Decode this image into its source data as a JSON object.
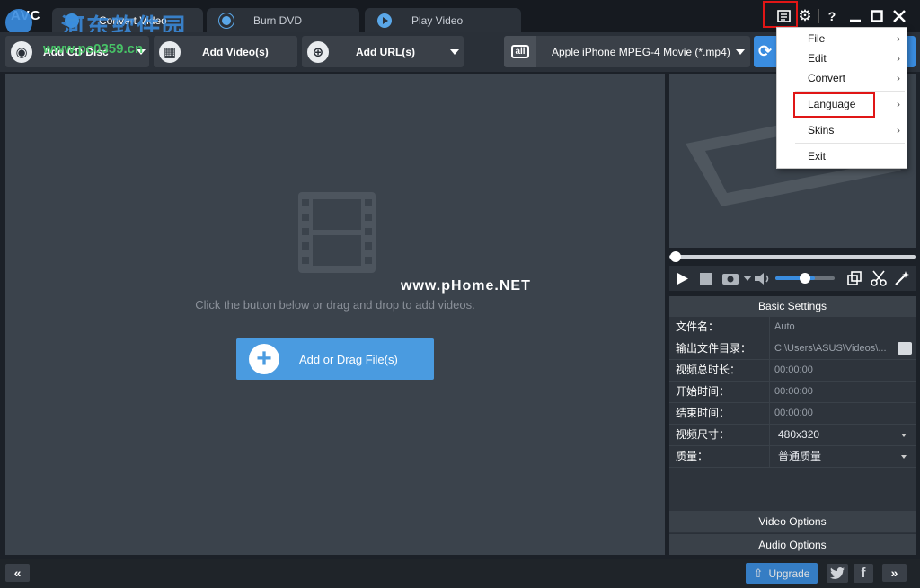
{
  "app": {
    "logo": "AVC"
  },
  "watermark": {
    "line1": "河东软件园",
    "line2": "www.pc0359.cn",
    "center": "www.pHome.NET"
  },
  "tabs": [
    {
      "label": "Convert Video"
    },
    {
      "label": "Burn DVD"
    },
    {
      "label": "Play Video"
    }
  ],
  "window_controls": {
    "help": "?"
  },
  "toolbar": {
    "add_cd": "Add CD Disc",
    "add_video": "Add Video(s)",
    "add_url": "Add URL(s)",
    "format_icon_label": "all",
    "format_value": "Apple iPhone MPEG-4 Movie (*.mp4)"
  },
  "main": {
    "hint": "Click the button below or drag and drop to add videos.",
    "add_button": "Add or Drag File(s)"
  },
  "settings": {
    "title": "Basic Settings",
    "rows": [
      {
        "k": "文件名：",
        "v": "Auto"
      },
      {
        "k": "输出文件目录：",
        "v": "C:\\Users\\ASUS\\Videos\\..."
      },
      {
        "k": "视频总时长：",
        "v": "00:00:00"
      },
      {
        "k": "开始时间：",
        "v": "00:00:00"
      },
      {
        "k": "结束时间：",
        "v": "00:00:00"
      },
      {
        "k": "视频尺寸：",
        "v": "480x320"
      },
      {
        "k": "质量：",
        "v": "普通质量"
      }
    ],
    "video_options": "Video Options",
    "audio_options": "Audio Options"
  },
  "menu": {
    "items": [
      {
        "label": "File"
      },
      {
        "label": "Edit"
      },
      {
        "label": "Convert"
      },
      {
        "label": "Language"
      },
      {
        "label": "Skins"
      },
      {
        "label": "Exit"
      }
    ]
  },
  "statusbar": {
    "upgrade": "Upgrade",
    "facebook": "f"
  },
  "colors": {
    "accent": "#4a9be0",
    "highlight": "#e01616",
    "panel": "#3b434c",
    "background": "#1c2128"
  }
}
